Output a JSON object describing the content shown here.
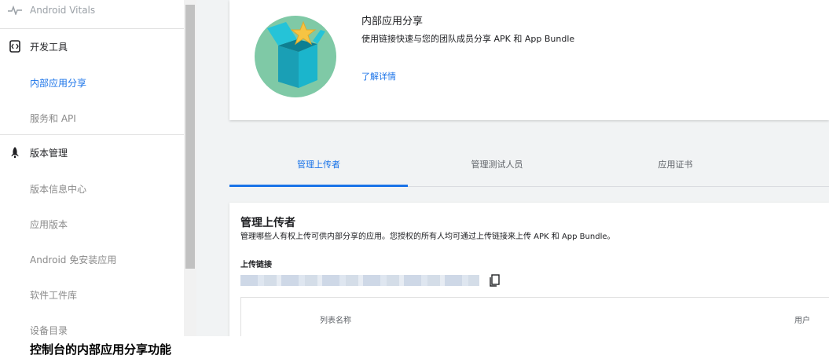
{
  "sidebar": {
    "items": [
      {
        "label": "Android Vitals",
        "icon": "vitals-pulse-icon"
      },
      {
        "label": "开发工具",
        "icon": "dev-tools-icon"
      },
      {
        "label": "内部应用分享"
      },
      {
        "label": "服务和 API"
      },
      {
        "label": "版本管理",
        "icon": "rocket-icon"
      },
      {
        "label": "版本信息中心"
      },
      {
        "label": "应用版本"
      },
      {
        "label": "Android 免安装应用"
      },
      {
        "label": "软件工件库"
      },
      {
        "label": "设备目录"
      }
    ]
  },
  "promo": {
    "title": "内部应用分享",
    "description": "使用链接快速与您的团队成员分享 APK 和 App Bundle",
    "learn_more": "了解详情"
  },
  "tabs": [
    {
      "label": "管理上传者",
      "active": true
    },
    {
      "label": "管理测试人员",
      "active": false
    },
    {
      "label": "应用证书",
      "active": false
    }
  ],
  "uploaders": {
    "title": "管理上传者",
    "description": "管理哪些人有权上传可供内部分享的应用。您授权的所有人均可通过上传链接来上传 APK 和 App Bundle。",
    "link_label": "上传链接",
    "columns": [
      "列表名称",
      "用户"
    ]
  },
  "caption": "控制台的内部应用分享功能",
  "colors": {
    "accent": "#1a73e8",
    "illustration_bg": "#7fc9a6",
    "box": "#1bb5cc",
    "star": "#f6c443"
  }
}
